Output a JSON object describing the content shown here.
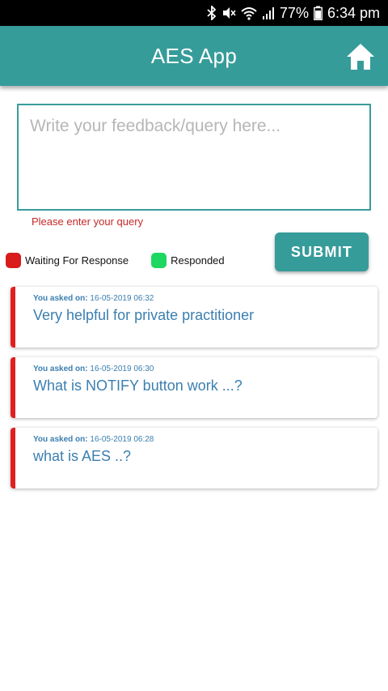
{
  "status_bar": {
    "battery": "77%",
    "time": "6:34 pm"
  },
  "app_bar": {
    "title": "AES App",
    "home_icon": "home-icon"
  },
  "form": {
    "placeholder": "Write your feedback/query here...",
    "value": "",
    "error": "Please enter your query",
    "submit_label": "SUBMIT"
  },
  "legend": [
    {
      "label": "Waiting For Response",
      "color": "#d81b1b"
    },
    {
      "label": "Responded",
      "color": "#1ed760"
    }
  ],
  "queries": [
    {
      "asked_label": "You asked on:",
      "date": "16-05-2019 06:32",
      "text": "Very helpful for private practitioner",
      "status_color": "#e02020"
    },
    {
      "asked_label": "You asked on:",
      "date": "16-05-2019 06:30",
      "text": "What is NOTIFY button work ...?",
      "status_color": "#e02020"
    },
    {
      "asked_label": "You asked on:",
      "date": "16-05-2019 06:28",
      "text": "what is AES ..?",
      "status_color": "#e02020"
    }
  ]
}
